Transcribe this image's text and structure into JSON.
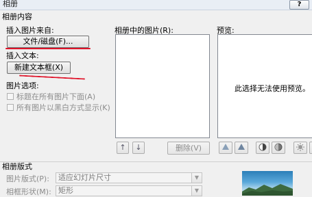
{
  "window": {
    "title": "相册",
    "help_button": "?"
  },
  "album_content": {
    "section_label": "相册内容",
    "insert_from_label": "插入图片来自:",
    "file_disk_button": "文件/磁盘(F)...",
    "insert_text_label": "插入文本:",
    "new_textbox_button": "新建文本框(X)",
    "picture_options_label": "图片选项:",
    "options": [
      {
        "label": "标题在所有图片下面(A)",
        "checked": false
      },
      {
        "label": "所有图片以黑白方式显示(K)",
        "checked": false
      }
    ]
  },
  "pictures_in_album": {
    "label": "相册中的图片(R):",
    "items": []
  },
  "preview": {
    "label": "预览:",
    "message": "此选择无法使用预览。"
  },
  "list_controls": {
    "move_up": "↑",
    "move_down": "↓",
    "remove_button": "删除(V)"
  },
  "album_layout": {
    "section_label": "相册版式",
    "picture_layout_label": "图片版式(P):",
    "picture_layout_value": "适应幻灯片尺寸",
    "frame_shape_label": "相框形状(M):",
    "frame_shape_value": "矩形"
  },
  "colors": {
    "annotation_red": "#e0142a"
  },
  "icons": [
    "rotate-left-icon",
    "rotate-right-icon",
    "contrast-up-icon",
    "contrast-down-icon",
    "brightness-up-icon",
    "brightness-down-icon",
    "image-adjust-icon"
  ]
}
